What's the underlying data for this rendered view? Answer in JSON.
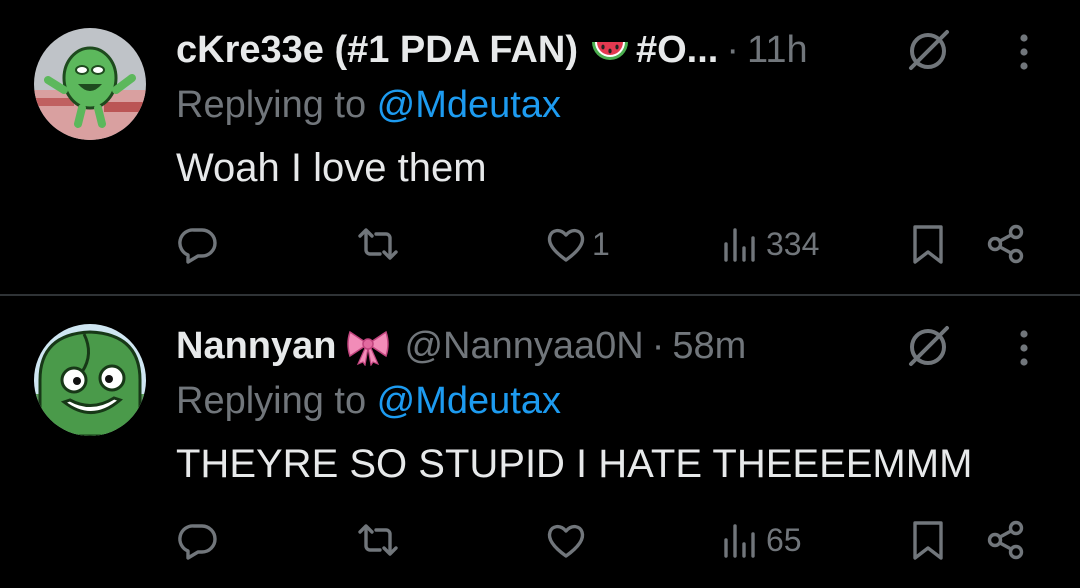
{
  "tweets": [
    {
      "author_name": "cKre33e (#1 PDA FAN)",
      "emoji": "watermelon",
      "name_suffix": "#O...",
      "handle": "",
      "separator": "·",
      "time": "11h",
      "replying_prefix": "Replying to ",
      "replying_to": "@Mdeutax",
      "text": "Woah I love them",
      "reply_count": "",
      "retweet_count": "",
      "like_count": "1",
      "view_count": "334"
    },
    {
      "author_name": "Nannyan",
      "emoji": "pink-bow",
      "name_suffix": "",
      "handle": "@Nannyaa0N",
      "separator": "·",
      "time": "58m",
      "replying_prefix": "Replying to ",
      "replying_to": "@Mdeutax",
      "text": "THEYRE SO STUPID I HATE THEEEEMMM",
      "reply_count": "",
      "retweet_count": "",
      "like_count": "",
      "view_count": "65"
    }
  ],
  "colors": {
    "background": "#000000",
    "primary_text": "#e7e9ea",
    "secondary_text": "#71767b",
    "link": "#1d9bf0",
    "divider": "#2f3336"
  },
  "icons": [
    "reply-icon",
    "retweet-icon",
    "like-icon",
    "views-icon",
    "bookmark-icon",
    "share-icon",
    "mute-icon",
    "more-icon"
  ]
}
